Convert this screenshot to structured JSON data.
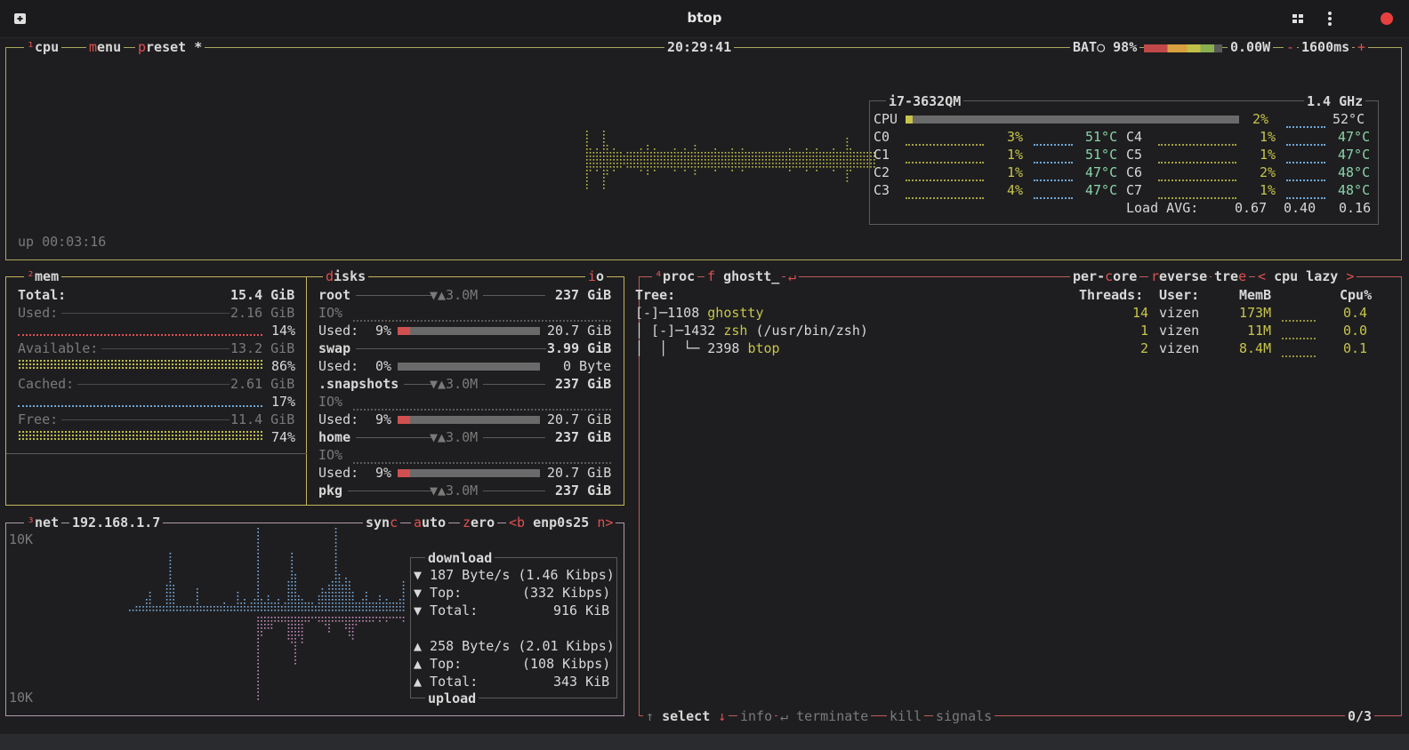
{
  "window": {
    "title": "btop"
  },
  "cpu": {
    "tab_num": "¹",
    "tab_label": "cpu",
    "menu_label": "menu",
    "preset_label": "preset *",
    "clock": "20:29:41",
    "battery": "BAT○ 98%",
    "power": "0.00W",
    "minus": "-",
    "interval": "1600ms",
    "plus": "+",
    "uptime": "up 00:03:16",
    "model": "i7-3632QM",
    "freq": "1.4 GHz",
    "total": {
      "label": "CPU",
      "pct": "2%",
      "temp": "52°C",
      "level": 0.02
    },
    "cores": [
      {
        "label": "C0",
        "pct": "3%",
        "temp": "51°C"
      },
      {
        "label": "C1",
        "pct": "1%",
        "temp": "51°C"
      },
      {
        "label": "C2",
        "pct": "1%",
        "temp": "47°C"
      },
      {
        "label": "C3",
        "pct": "4%",
        "temp": "47°C"
      },
      {
        "label": "C4",
        "pct": "1%",
        "temp": "47°C"
      },
      {
        "label": "C5",
        "pct": "1%",
        "temp": "47°C"
      },
      {
        "label": "C6",
        "pct": "2%",
        "temp": "48°C"
      },
      {
        "label": "C7",
        "pct": "1%",
        "temp": "48°C"
      }
    ],
    "load_label": "Load AVG:",
    "load": [
      "0.67",
      "0.40",
      "0.16"
    ]
  },
  "mem": {
    "tab_num": "²",
    "tab_label": "mem",
    "total_label": "Total:",
    "total": "15.4 GiB",
    "rows": [
      {
        "label": "Used:",
        "value": "2.16 GiB",
        "pct": "14%",
        "color": "#e05050"
      },
      {
        "label": "Available:",
        "value": "13.2 GiB",
        "pct": "86%",
        "color": "#c7c44a"
      },
      {
        "label": "Cached:",
        "value": "2.61 GiB",
        "pct": "17%",
        "color": "#6fa8d8"
      },
      {
        "label": "Free:",
        "value": "11.4 GiB",
        "pct": "74%",
        "color": "#c7c44a"
      }
    ]
  },
  "disks": {
    "tab_label": "disks",
    "io_label": "io",
    "items": [
      {
        "name": "root",
        "io": "▼▲3.0M",
        "size": "237 GiB",
        "io_label": "IO%",
        "used_label": "Used:",
        "used_pct": "9%",
        "used_level": 0.09,
        "used": "20.7 GiB"
      },
      {
        "name": "swap",
        "io": "",
        "size": "3.99 GiB",
        "io_label": "",
        "used_label": "Used:",
        "used_pct": "0%",
        "used_level": 0.0,
        "used": "0 Byte"
      },
      {
        "name": ".snapshots",
        "io": "▼▲3.0M",
        "size": "237 GiB",
        "io_label": "IO%",
        "used_label": "Used:",
        "used_pct": "9%",
        "used_level": 0.09,
        "used": "20.7 GiB"
      },
      {
        "name": "home",
        "io": "▼▲3.0M",
        "size": "237 GiB",
        "io_label": "IO%",
        "used_label": "Used:",
        "used_pct": "9%",
        "used_level": 0.09,
        "used": "20.7 GiB"
      },
      {
        "name": "pkg",
        "io": "▼▲3.0M",
        "size": "237 GiB"
      }
    ]
  },
  "net": {
    "tab_num": "³",
    "tab_label": "net",
    "ip": "192.168.1.7",
    "sync": "sync",
    "auto": "auto",
    "zero": "zero",
    "b": "<b",
    "iface": "enp0s25",
    "n": "n>",
    "scale_top": "10K",
    "scale_bottom": "10K",
    "download_title": "download",
    "upload_title": "upload",
    "down_rate": "▼ 187 Byte/s (1.46 Kibps)",
    "down_top_label": "▼ Top:",
    "down_top": "(332 Kibps)",
    "down_total_label": "▼ Total:",
    "down_total": "916 KiB",
    "up_rate": "▲ 258 Byte/s (2.01 Kibps)",
    "up_top_label": "▲ Top:",
    "up_top": "(108 Kibps)",
    "up_total_label": "▲ Total:",
    "up_total": "343 KiB"
  },
  "proc": {
    "tab_num": "⁴",
    "tab_label": "proc",
    "filter_key": "f",
    "filter": "ghostt_",
    "enter": "↵",
    "per_core": "per-core",
    "reverse": "reverse",
    "tree": "tree",
    "lt": "<",
    "sort": "cpu lazy",
    "gt": ">",
    "headers": {
      "tree": "Tree:",
      "threads": "Threads:",
      "user": "User:",
      "mem": "MemB",
      "cpu": "Cpu%"
    },
    "rows": [
      {
        "prefix": "[-]─1108 ",
        "name": "ghostty",
        "args": "",
        "threads": "14",
        "user": "vizen",
        "mem": "173M",
        "cpu": "0.4"
      },
      {
        "prefix": "│ [-]─1432 ",
        "name": "zsh",
        "args": " (/usr/bin/zsh)",
        "threads": "1",
        "user": "vizen",
        "mem": "11M",
        "cpu": "0.0"
      },
      {
        "prefix": "│  │  └─ 2398 ",
        "name": "btop",
        "args": "",
        "threads": "2",
        "user": "vizen",
        "mem": "8.4M",
        "cpu": "0.1"
      }
    ],
    "footer": {
      "up": "↑",
      "select": "select",
      "down": "↓",
      "info": "info",
      "enter": "↵",
      "terminate": "terminate",
      "kill": "kill",
      "signals": "signals",
      "count": "0/3"
    }
  },
  "colors": {
    "cpu_border": "#a9a760",
    "mem_border": "#c4b45a",
    "net_border": "#b09aa8",
    "proc_border": "#c05a5a",
    "accent_red": "#e05050"
  }
}
